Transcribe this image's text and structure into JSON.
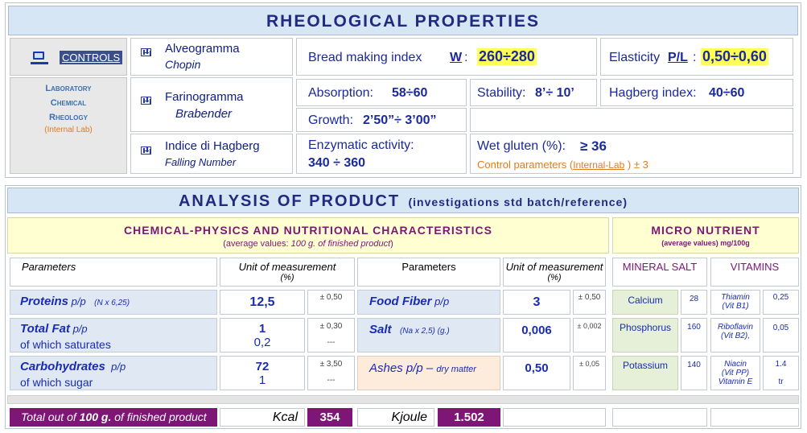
{
  "rheology": {
    "title": "RHEOLOGICAL PROPERTIES",
    "controls_label": "CONTROLS",
    "lab_line1": "Laboratory",
    "lab_line2": "Chemical",
    "lab_line3": "Rheology",
    "lab_line4": "(Internal Lab)",
    "tests": [
      {
        "name": "Alveogramma",
        "sub": "Chopin"
      },
      {
        "name": "Farinogramma",
        "sub": "Brabender"
      },
      {
        "name": "Indice di Hagberg",
        "sub": "Falling Number"
      }
    ],
    "bread_label": "Bread making index",
    "bread_key": "W",
    "bread_colon": ":",
    "bread_value": "260÷280",
    "elasticity_label": "Elasticity",
    "elasticity_key": "P/L",
    "elasticity_colon": ":",
    "elasticity_value": "0,50÷0,60",
    "absorption_label": "Absorption:",
    "absorption_value": "58÷60",
    "stability_label": "Stability:",
    "stability_value": "8’÷ 10’",
    "hagberg_label": "Hagberg index:",
    "hagberg_value": "40÷60",
    "growth_label": "Growth:",
    "growth_value": "2’50”÷ 3’00”",
    "enzymatic_label": "Enzymatic activity:",
    "enzymatic_value": "340 ÷ 360",
    "gluten_label": "Wet gluten (%):",
    "gluten_value": "≥ 36",
    "control_params_pre": "Control parameters (",
    "control_params_link": "Internal-Lab",
    "control_params_post": " ) ± 3"
  },
  "analysis": {
    "title": "ANALYSIS OF PRODUCT",
    "subtitle": "(investigations std batch/reference)",
    "chem_title": "CHEMICAL-PHYSICS AND NUTRITIONAL CHARACTERISTICS",
    "chem_sub_pre": "(average values: ",
    "chem_sub_em": "100 g. of finished product",
    "chem_sub_post": ")",
    "micro_title": "MICRO NUTRIENT",
    "micro_sub": "(average values) mg/100g",
    "col_parameters": "Parameters",
    "col_unit": "Unit of measurement",
    "col_unit_sub": "(%)",
    "mineral_salt": "MINERAL SALT",
    "vitamins": "VITAMINS",
    "left_rows": [
      {
        "label": "Proteins",
        "suffix": " p/p",
        "note": "(N x 6,25)",
        "value": "12,5",
        "tol": "± 0,50",
        "sub_label": "",
        "sub_value": "",
        "sub_tol": ""
      },
      {
        "label": "Total Fat",
        "suffix": " p/p",
        "note": "",
        "value": "1",
        "tol": "± 0,30",
        "sub_label": "of which saturates",
        "sub_value": "0,2",
        "sub_tol": "---"
      },
      {
        "label": "Carbohydrates",
        "suffix": "  p/p",
        "note": "",
        "value": "72",
        "tol": "± 3,50",
        "sub_label": "of which sugar",
        "sub_value": "1",
        "sub_tol": "---"
      }
    ],
    "right_rows": [
      {
        "label": "Food Fiber",
        "suffix": " p/p",
        "note": "",
        "value": "3",
        "tol": "± 0,50"
      },
      {
        "label": "Salt",
        "suffix": "",
        "note": "(Na x 2,5) (g.)",
        "value": "0,006",
        "tol": "± 0,002"
      },
      {
        "label": "Ashes p/p – ",
        "suffix": "dry matter",
        "note": "",
        "value": "0,50",
        "tol": "± 0,05"
      }
    ],
    "minerals": [
      {
        "name": "Calcium",
        "value": "28"
      },
      {
        "name": "Phosphorus",
        "value": "160"
      },
      {
        "name": "Potassium",
        "value": "140"
      }
    ],
    "vitamins_list": [
      {
        "name1": "Thiamin",
        "name2": "(Vit B1)",
        "name3": "",
        "value": "0,25",
        "value2": ""
      },
      {
        "name1": "Riboflavin",
        "name2": "(Vit B2),",
        "name3": "",
        "value": "0,05",
        "value2": ""
      },
      {
        "name1": "Niacin",
        "name2": "(Vit PP)",
        "name3": "Vitamin E",
        "value": "1.4",
        "value2": "tr"
      }
    ],
    "total_pre": "Total out of ",
    "total_bold": "100 g.",
    "total_post": " of finished product",
    "kcal_label": "Kcal",
    "kcal_value": "354",
    "kjoule_label": "Kjoule",
    "kjoule_value": "1.502"
  }
}
